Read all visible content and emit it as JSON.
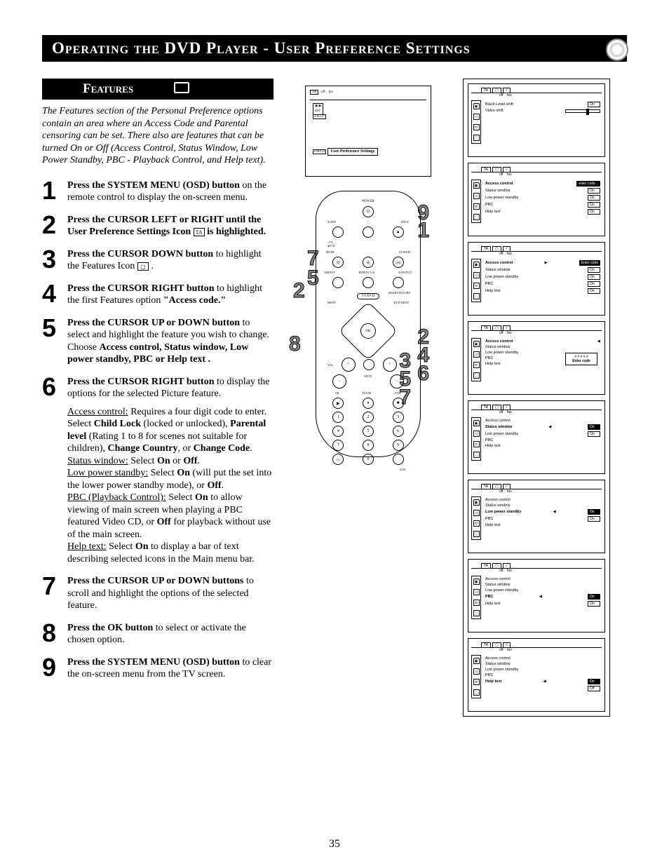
{
  "page_number": "35",
  "title": "Operating the DVD Player - User Preference Settings",
  "features_heading": "Features",
  "intro": "The Features section of the Personal Preference options contain an area where an Access Code and Parental censoring can be set. There also are features that can be turned On or Off (Access Control, Status Window, Low Power Standby, PBC - Playback Control, and Help text).",
  "steps": {
    "s1": {
      "bold": "Press the SYSTEM MENU (OSD) button",
      "rest": " on the remote control to display the on-screen menu."
    },
    "s2": {
      "bold": "Press the CURSOR LEFT or RIGHT until the User Preference Settings Icon ",
      "rest": " is highlighted."
    },
    "s3": {
      "bold": "Press the CURSOR DOWN button",
      "rest": " to highlight the Features  Icon "
    },
    "s4": {
      "bold": "Press the CURSOR RIGHT button",
      "rest": " to highlight the first Features option ",
      "bold2": "\"Access code.\""
    },
    "s5": {
      "bold": "Press the CURSOR UP or DOWN button",
      "rest": " to select and highlight the feature you wish to change. Choose ",
      "bold2": "Access control, Status window, Low power standby, PBC or Help text ."
    },
    "s6": {
      "bold": "Press the CURSOR RIGHT button",
      "rest": " to display the options for the selected Picture feature."
    },
    "s7": {
      "bold": "Press the CURSOR UP or DOWN buttons",
      "rest": " to scroll and highlight the options of the selected feature."
    },
    "s8": {
      "bold": "Press the OK button",
      "rest": " to select or activate the chosen option."
    },
    "s9": {
      "bold": "Press the SYSTEM MENU (OSD) button",
      "rest": " to clear the on-screen menu from the TV screen."
    }
  },
  "step6_details": {
    "access_label": "Access control:",
    "access_text": " Requires a four digit code to enter. Select ",
    "access_b1": "Child Lock",
    "access_text2": " (locked or unlocked), ",
    "access_b2": "Parental level",
    "access_text3": " (Rating 1 to 8 for scenes not suitable for children), ",
    "access_b3": "Change Country",
    "access_text4": ", or ",
    "access_b4": "Change Code",
    "access_text5": ".",
    "status_label": "Status window:",
    "status_text": " Select ",
    "on": "On",
    "or": " or ",
    "off": "Off",
    "dot": ".",
    "lpw_label": "Low power standby:",
    "lpw_text1": " Select ",
    "lpw_on": "On",
    "lpw_text2": " (will put the set into the lower power standby mode), or ",
    "lpw_off": "Off",
    "pbc_label": "PBC (Playback Control):",
    "pbc_text1": " Select ",
    "pbc_on": "On",
    "pbc_text2": " to allow viewing of main screen when playing a PBC featured Video CD, or ",
    "pbc_off": "Off",
    "pbc_text3": " for playback without use of the main screen.",
    "help_label": "Help text:",
    "help_text1": " Select ",
    "help_on": "On",
    "help_text2": " to display a bar of text describing selected icons in the Main menu bar."
  },
  "screen_mock": {
    "tabs": {
      "off": "off",
      "fav": "fav"
    },
    "corner": {
      "l1": "dvd",
      "l2": "2:45:27",
      "l3": "0:00:14"
    },
    "label": "User Preference Settings"
  },
  "remote": {
    "power": "POWER",
    "sleep": "SLEEP",
    "eject": "EJECT",
    "tv": "TV",
    "vcr": "VCR",
    "osd": "OSD",
    "mode": "MODE",
    "system": "SYSTEM",
    "repeat": "REPEAT",
    "repeat_ab": "REPEAT A-B",
    "subtitle": "SUBTITLE",
    "smart": "SMART PICTURE",
    "tvdvd": "TV/DVD",
    "menu": "MENU",
    "dvd_menu": "DVD MENU",
    "ok": "OK",
    "vol": "VOL",
    "ch": "CH",
    "mute": "MUTE",
    "pause": "PAUSE",
    "stop": "STOP",
    "cc": "CC",
    "acr": "ACR."
  },
  "callouts": {
    "c1": "1",
    "c2": "2",
    "c3": "3",
    "c4": "4",
    "c5": "5",
    "c6": "6",
    "c7": "7",
    "c8": "8",
    "c9": "9",
    "c2b": "2",
    "c5b": "5",
    "c7b": "7"
  },
  "right_screens": {
    "tabs": {
      "off": "off",
      "fav": "fav"
    },
    "scr1": {
      "r1": "Black Level shift",
      "v1": "On",
      "r2": "Video shift"
    },
    "scr2": {
      "r1": "Access control",
      "v1": "enter code...",
      "r2": "Status window",
      "v2": "On",
      "r3": "Low power standby",
      "v3": "On",
      "r4": "PBC",
      "v4": "On",
      "r5": "Help text",
      "v5": "On"
    },
    "scr3": {
      "r1": "Access control",
      "v1": "Enter code",
      "r2": "Status window",
      "v2": "On",
      "r3": "Low power standby",
      "v3": "On",
      "r4": "PBC",
      "v4": "On",
      "r5": "Help text",
      "v5": "On"
    },
    "scr4": {
      "r1": "Access control",
      "r2": "Status window",
      "r3": "Low power standby",
      "r4": "PBC",
      "r5": "Help text",
      "dlg1": "# # # # #",
      "dlg2": "Enter code"
    },
    "scr5": {
      "r1": "Access control",
      "r2": "Status window",
      "v2": "On",
      "r3": "Low power standby",
      "v3": "On",
      "r4": "PBC",
      "r5": "Help text"
    },
    "scr6": {
      "r1": "Access control",
      "r2": "Status window",
      "r3": "Low power standby",
      "v3": "On",
      "r4": "PBC",
      "v4": "On",
      "r5": "Help text"
    },
    "scr7": {
      "r1": "Access control",
      "r2": "Status window",
      "r3": "Low power standby",
      "r4": "PBC",
      "v4": "On",
      "r5": "Help text",
      "v5": "On"
    },
    "scr8": {
      "r1": "Access control",
      "r2": "Status window",
      "r3": "Low power standby",
      "r4": "PBC",
      "r5": "Help text",
      "v5": "On",
      "vOff": "Off"
    }
  }
}
